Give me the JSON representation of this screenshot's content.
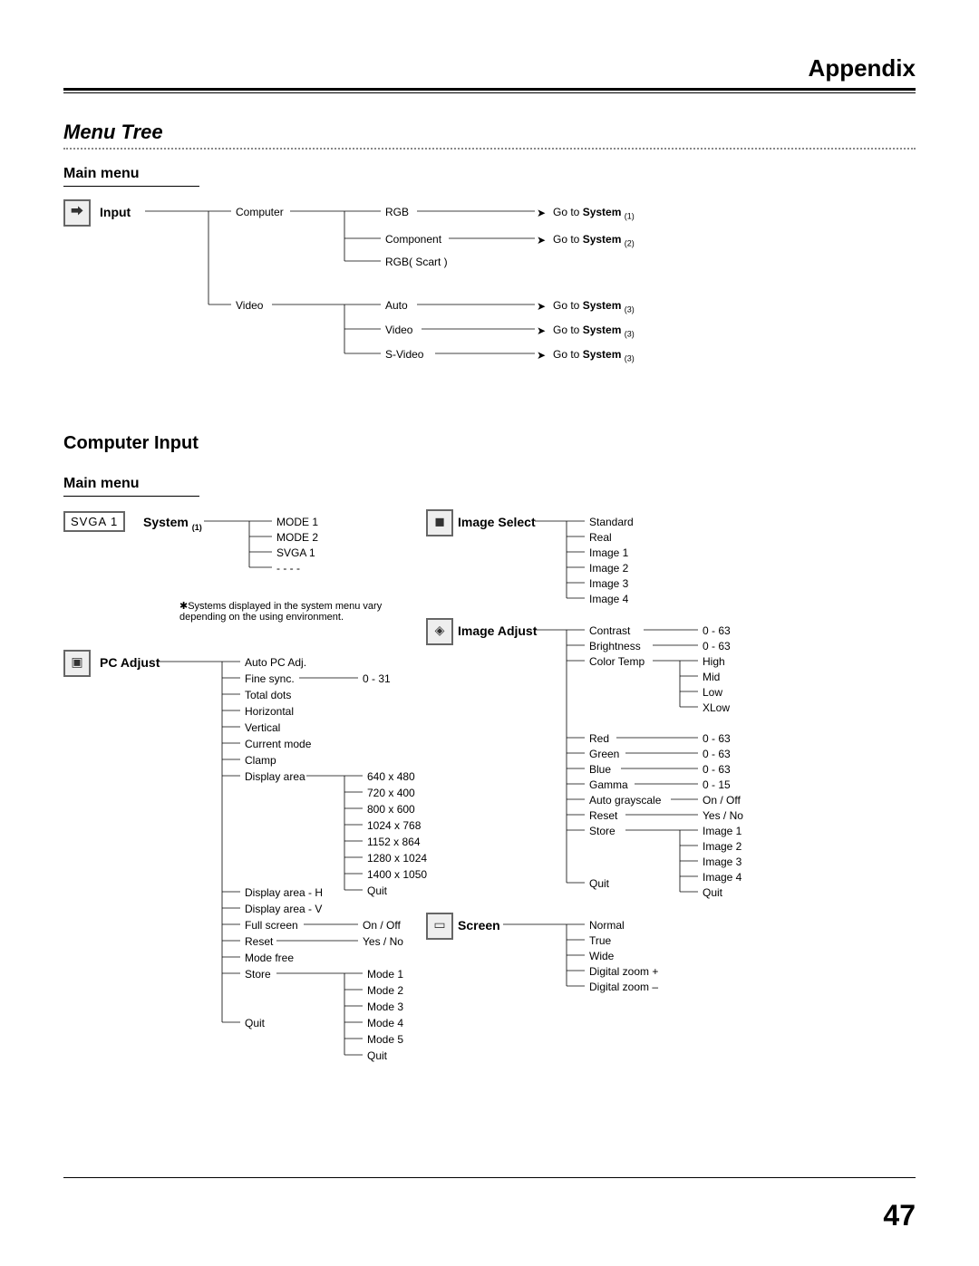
{
  "header": "Appendix",
  "title": "Menu Tree",
  "main_menu_label": "Main menu",
  "computer_input_label": "Computer Input",
  "page_number": "47",
  "input": {
    "label": "Input",
    "computer": "Computer",
    "video": "Video",
    "rgb": "RGB",
    "component": "Component",
    "rgb_scart": "RGB( Scart )",
    "auto": "Auto",
    "video2": "Video",
    "svideo": "S-Video",
    "goto_system": "Go to ",
    "system": "System",
    "s1": "(1)",
    "s2": "(2)",
    "s3": "(3)"
  },
  "system_menu": {
    "label": "System",
    "sub": "(1)",
    "svga1": "SVGA 1",
    "mode1": "MODE 1",
    "mode2": "MODE 2",
    "svga1_item": "SVGA 1",
    "dots": "- - - -",
    "footnote_star": "✱",
    "footnote": "Systems displayed in the system menu vary depending on the using environment."
  },
  "pc_adjust": {
    "label": "PC Adjust",
    "auto_pc": "Auto PC Adj.",
    "fine_sync": "Fine sync.",
    "fine_sync_range": "0 - 31",
    "total_dots": "Total dots",
    "horizontal": "Horizontal",
    "vertical": "Vertical",
    "current_mode": "Current mode",
    "clamp": "Clamp",
    "display_area": "Display area",
    "res": [
      "640 x 480",
      "720 x 400",
      "800 x 600",
      "1024 x 768",
      "1152 x 864",
      "1280 x 1024",
      "1400 x 1050",
      "Quit"
    ],
    "display_area_h": "Display area - H",
    "display_area_v": "Display area - V",
    "full_screen": "Full screen",
    "full_screen_val": "On / Off",
    "reset": "Reset",
    "reset_val": "Yes / No",
    "mode_free": "Mode free",
    "store": "Store",
    "modes": [
      "Mode 1",
      "Mode 2",
      "Mode 3",
      "Mode 4",
      "Mode 5",
      "Quit"
    ],
    "quit": "Quit"
  },
  "image_select": {
    "label": "Image Select",
    "items": [
      "Standard",
      "Real",
      "Image 1",
      "Image 2",
      "Image 3",
      "Image 4"
    ]
  },
  "image_adjust": {
    "label": "Image Adjust",
    "contrast": "Contrast",
    "contrast_r": "0 - 63",
    "brightness": "Brightness",
    "brightness_r": "0 - 63",
    "color_temp": "Color Temp",
    "temps": [
      "High",
      "Mid",
      "Low",
      "XLow"
    ],
    "red": "Red",
    "red_r": "0 - 63",
    "green": "Green",
    "green_r": "0 - 63",
    "blue": "Blue",
    "blue_r": "0 - 63",
    "gamma": "Gamma",
    "gamma_r": "0 - 15",
    "auto_gray": "Auto grayscale",
    "auto_gray_r": "On / Off",
    "reset": "Reset",
    "reset_r": "Yes / No",
    "store": "Store",
    "store_items": [
      "Image 1",
      "Image 2",
      "Image 3",
      "Image 4",
      "Quit"
    ],
    "quit": "Quit"
  },
  "screen": {
    "label": "Screen",
    "items": [
      "Normal",
      "True",
      "Wide",
      "Digital zoom +",
      "Digital zoom –"
    ]
  }
}
